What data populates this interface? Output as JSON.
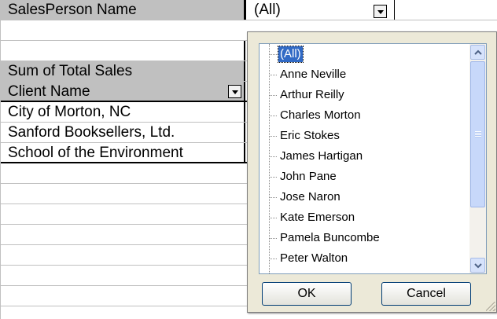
{
  "pivot": {
    "page_field_label": "SalesPerson Name",
    "page_field_value": "(All)",
    "data_field_label": "Sum of Total Sales",
    "row_field_label": "Client Name",
    "rows": [
      "City of Morton, NC",
      "Sanford Booksellers, Ltd.",
      "School of the Environment"
    ]
  },
  "filter_popup": {
    "items": [
      "(All)",
      "Anne Neville",
      "Arthur Reilly",
      "Charles Morton",
      "Eric Stokes",
      "James Hartigan",
      "John Pane",
      "Jose Naron",
      "Kate Emerson",
      "Pamela Buncombe",
      "Peter Walton"
    ],
    "selected_index": 0,
    "ok_label": "OK",
    "cancel_label": "Cancel"
  },
  "colors": {
    "header_fill": "#c0c0c0",
    "selection": "#316ac5",
    "dialog_bg": "#ece9d8"
  }
}
